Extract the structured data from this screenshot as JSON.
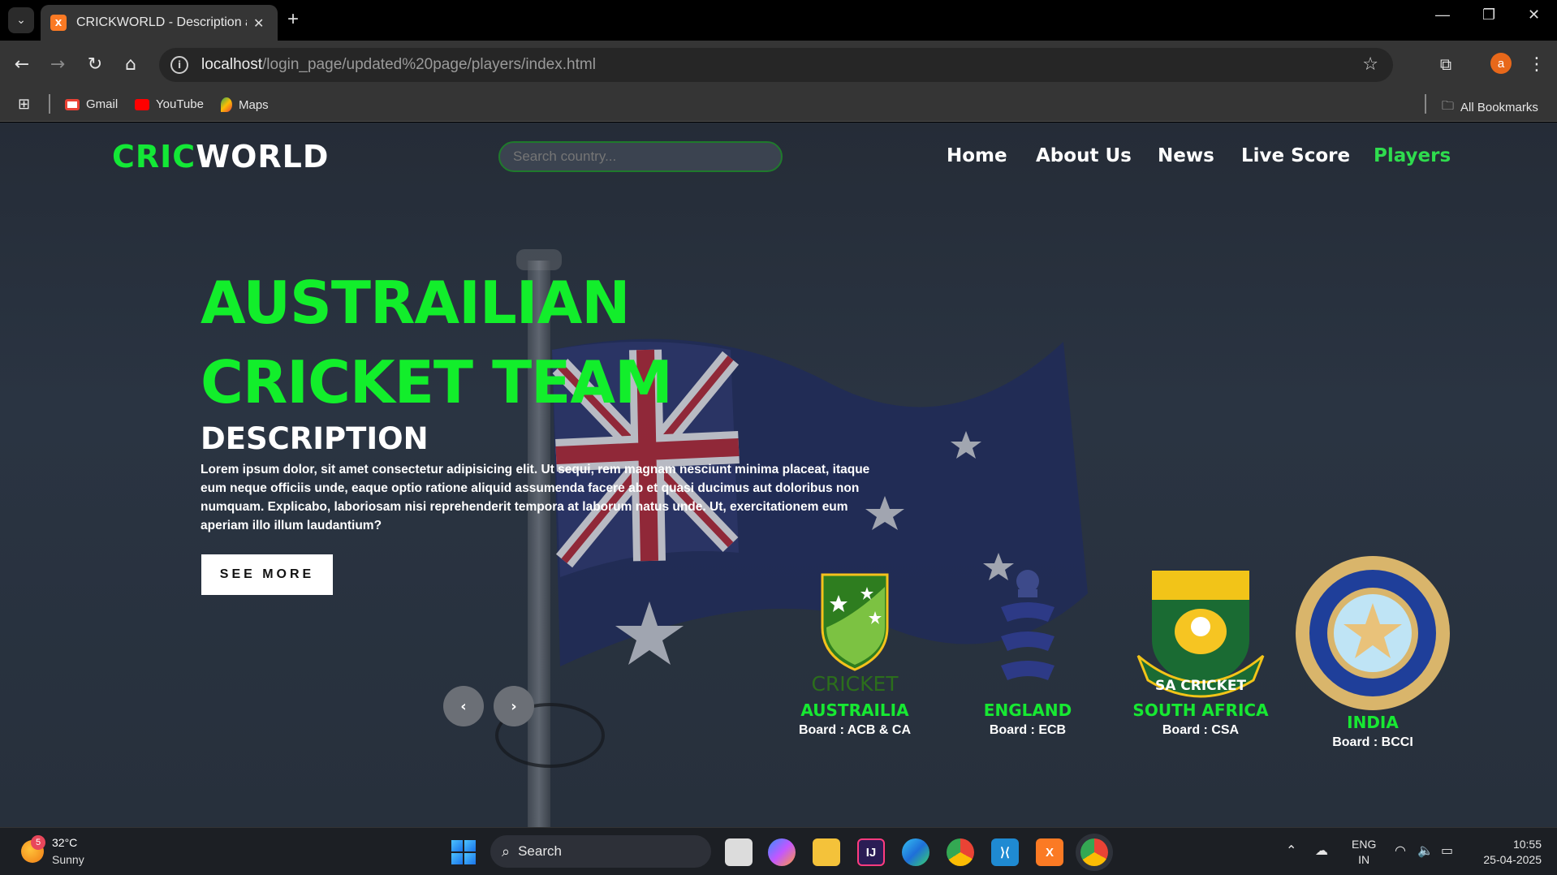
{
  "browser": {
    "tab_title": "CRICKWORLD - Description abc",
    "url_host": "localhost",
    "url_path": "/login_page/updated%20page/players/index.html",
    "profile_initial": "a",
    "bookmarks": [
      {
        "label": "Gmail",
        "icon": "gmail-icon"
      },
      {
        "label": "YouTube",
        "icon": "youtube-icon"
      },
      {
        "label": "Maps",
        "icon": "maps-icon"
      }
    ],
    "all_bookmarks": "All Bookmarks"
  },
  "site": {
    "logo_part1": "CRIC",
    "logo_part2": "WORLD",
    "search_placeholder": "Search country...",
    "nav": [
      "Home",
      "About Us",
      "News",
      "Live Score",
      "Players"
    ],
    "active_nav": "Players",
    "accent_color": "#13e836"
  },
  "hero": {
    "title": "AUSTRAILIAN CRICKET TEAM",
    "description_heading": "DESCRIPTION",
    "description": "Lorem ipsum dolor, sit amet consectetur adipisicing elit. Ut sequi, rem magnam nesciunt minima placeat, itaque eum neque officiis unde, eaque optio ratione aliquid assumenda facere ab et quasi ducimus aut doloribus non numquam. Explicabo, laboriosam nisi reprehenderit tempora at laborum natus unde. Ut, exercitationem eum aperiam illo illum laudantium?",
    "button": "SEE MORE",
    "prev": "‹",
    "next": "›"
  },
  "teams": [
    {
      "name": "AUSTRAILIA",
      "board": "Board : ACB & CA",
      "logo_text": "CRICKET"
    },
    {
      "name": "ENGLAND",
      "board": "Board : ECB"
    },
    {
      "name": "SOUTH AFRICA",
      "board": "Board : CSA",
      "logo_text": "SA CRICKET"
    },
    {
      "name": "INDIA",
      "board": "Board : BCCI"
    }
  ],
  "taskbar": {
    "weather_badge": "5",
    "temperature": "32°C",
    "condition": "Sunny",
    "search": "Search",
    "lang_top": "ENG",
    "lang_bottom": "IN",
    "time": "10:55",
    "date": "25-04-2025"
  }
}
